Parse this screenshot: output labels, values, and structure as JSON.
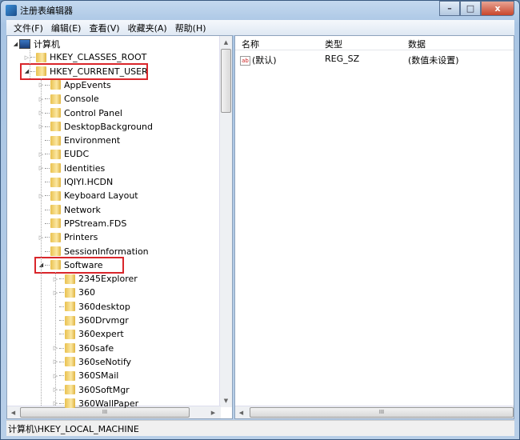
{
  "window": {
    "title": "注册表编辑器",
    "minimize": "–",
    "maximize": "□",
    "close": "x"
  },
  "menu": [
    "文件(F)",
    "编辑(E)",
    "查看(V)",
    "收藏夹(A)",
    "帮助(H)"
  ],
  "tree": {
    "root": "计算机",
    "hives": [
      {
        "label": "HKEY_CLASSES_ROOT",
        "expandable": true,
        "expanded": false
      },
      {
        "label": "HKEY_CURRENT_USER",
        "expandable": true,
        "expanded": true,
        "highlighted": true
      }
    ],
    "hkcu_children": [
      {
        "label": "AppEvents",
        "expandable": true
      },
      {
        "label": "Console",
        "expandable": true
      },
      {
        "label": "Control Panel",
        "expandable": true
      },
      {
        "label": "DesktopBackground",
        "expandable": true
      },
      {
        "label": "Environment",
        "expandable": false
      },
      {
        "label": "EUDC",
        "expandable": true
      },
      {
        "label": "Identities",
        "expandable": true
      },
      {
        "label": "IQIYI.HCDN",
        "expandable": false
      },
      {
        "label": "Keyboard Layout",
        "expandable": true
      },
      {
        "label": "Network",
        "expandable": false
      },
      {
        "label": "PPStream.FDS",
        "expandable": false
      },
      {
        "label": "Printers",
        "expandable": true
      },
      {
        "label": "SessionInformation",
        "expandable": false
      },
      {
        "label": "Software",
        "expandable": true,
        "expanded": true,
        "highlighted": true
      }
    ],
    "software_children": [
      {
        "label": "2345Explorer",
        "expandable": true
      },
      {
        "label": "360",
        "expandable": true
      },
      {
        "label": "360desktop",
        "expandable": false
      },
      {
        "label": "360Drvmgr",
        "expandable": false
      },
      {
        "label": "360expert",
        "expandable": false
      },
      {
        "label": "360safe",
        "expandable": true
      },
      {
        "label": "360seNotify",
        "expandable": true
      },
      {
        "label": "360SMail",
        "expandable": true
      },
      {
        "label": "360SoftMgr",
        "expandable": true
      },
      {
        "label": "360WallPaper",
        "expandable": true
      }
    ]
  },
  "list": {
    "columns": [
      "名称",
      "类型",
      "数据"
    ],
    "rows": [
      {
        "icon": "ab",
        "name": "(默认)",
        "type": "REG_SZ",
        "data": "(数值未设置)"
      }
    ]
  },
  "scroll_glyph": "III",
  "status": "计算机\\HKEY_LOCAL_MACHINE",
  "colors": {
    "highlight_box": "#d9262b"
  }
}
